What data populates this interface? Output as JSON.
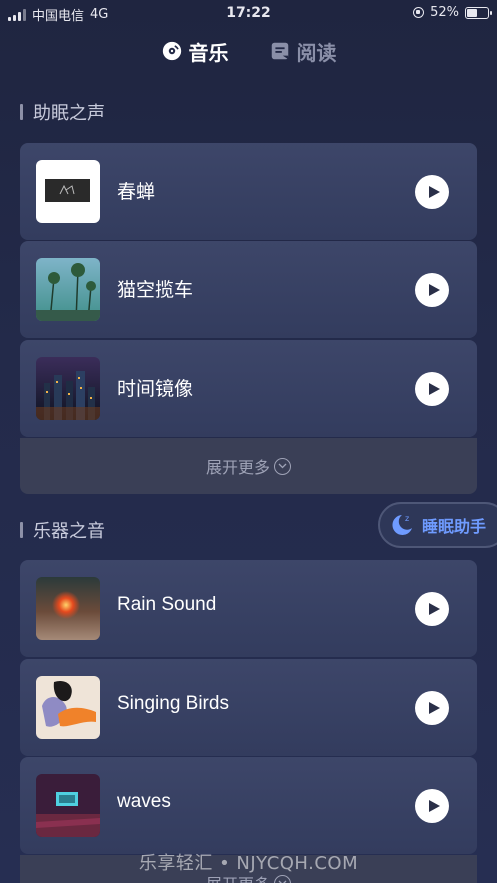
{
  "status_bar": {
    "carrier": "中国电信",
    "network": "4G",
    "time": "17:22",
    "battery_text": "52%",
    "battery_level": 0.52
  },
  "tabs": [
    {
      "label": "音乐",
      "icon": "music-disc-icon",
      "active": true
    },
    {
      "label": "阅读",
      "icon": "book-icon",
      "active": false
    }
  ],
  "sections": [
    {
      "title": "助眠之声",
      "items": [
        {
          "title": "春蝉",
          "thumb": "logo-thumb"
        },
        {
          "title": "猫空揽车",
          "thumb": "palm-trees-thumb"
        },
        {
          "title": "时间镜像",
          "thumb": "city-night-thumb"
        }
      ],
      "more_label": "展开更多"
    },
    {
      "title": "乐器之音",
      "items": [
        {
          "title": "Rain Sound",
          "thumb": "fire-thumb"
        },
        {
          "title": "Singing Birds",
          "thumb": "abstract-art-thumb"
        },
        {
          "title": "waves",
          "thumb": "cinema-thumb"
        }
      ],
      "more_label": "展开更多"
    }
  ],
  "sleep_assistant": {
    "label": "睡眠助手",
    "icon": "moon-zzz-icon"
  },
  "watermark": "乐享轻汇 • NJYCQH.COM",
  "colors": {
    "accent": "#6f9bff",
    "card": "#3a4366",
    "background": "#222845"
  }
}
